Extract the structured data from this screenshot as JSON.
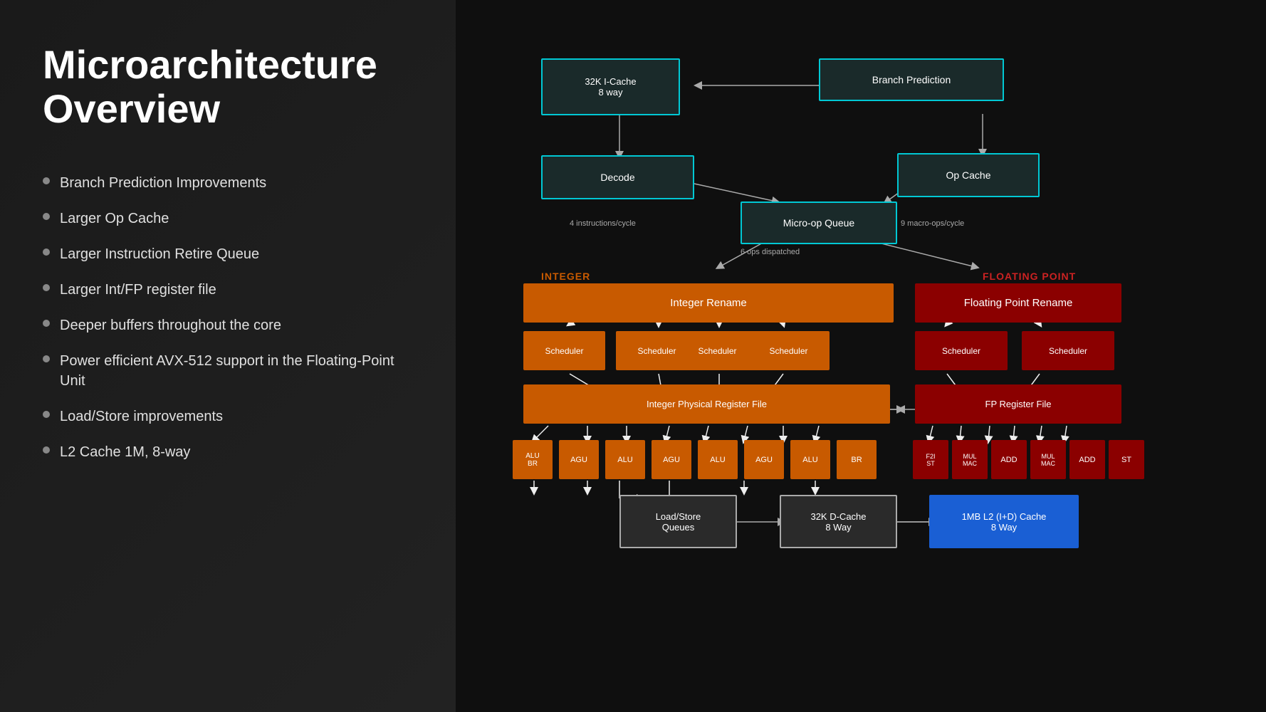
{
  "left": {
    "title": "Microarchitecture Overview",
    "bullets": [
      "Branch Prediction Improvements",
      "Larger Op Cache",
      "Larger Instruction Retire Queue",
      "Larger Int/FP register file",
      "Deeper buffers throughout the core",
      "Power efficient AVX-512 support in the Floating-Point Unit",
      "Load/Store improvements",
      "L2 Cache 1M, 8-way"
    ]
  },
  "diagram": {
    "icache": "32K I-Cache\n8 way",
    "branch_prediction": "Branch Prediction",
    "decode": "Decode",
    "op_cache": "Op Cache",
    "micro_op_queue": "Micro-op Queue",
    "annotation_4ins": "4 instructions/cycle",
    "annotation_6ops": "6 ops dispatched",
    "annotation_9macro": "9 macro-ops/cycle",
    "label_integer": "INTEGER",
    "label_fp": "FLOATING POINT",
    "integer_rename": "Integer Rename",
    "fp_rename": "Floating Point Rename",
    "int_schedulers": [
      "Scheduler",
      "Scheduler",
      "Scheduler",
      "Scheduler"
    ],
    "fp_schedulers": [
      "Scheduler",
      "Scheduler"
    ],
    "int_reg_file": "Integer Physical Register File",
    "fp_reg_file": "FP Register File",
    "int_units": [
      "ALU\nBR",
      "AGU",
      "ALU",
      "AGU",
      "ALU",
      "AGU",
      "ALU",
      "BR"
    ],
    "fp_units": [
      "F2I\nST",
      "MUL\nMAC",
      "ADD",
      "MUL\nMAC",
      "ADD",
      "ST"
    ],
    "load_store": "Load/Store\nQueues",
    "dcache": "32K D-Cache\n8 Way",
    "l2cache": "1MB L2 (I+D) Cache\n8 Way"
  }
}
